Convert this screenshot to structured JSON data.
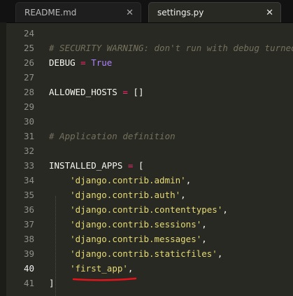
{
  "tabs": [
    {
      "label": "README.md",
      "close": "✕",
      "active": false
    },
    {
      "label": "settings.py",
      "close": "✕",
      "active": true
    }
  ],
  "editor": {
    "current_line": "40",
    "lines": [
      {
        "number": "24",
        "segments": []
      },
      {
        "number": "25",
        "segments": [
          {
            "t": "# SECURITY WARNING: don't run with debug turned on in production!",
            "c": "comment"
          }
        ]
      },
      {
        "number": "26",
        "segments": [
          {
            "t": "DEBUG",
            "c": "plain"
          },
          {
            "t": " ",
            "c": "plain"
          },
          {
            "t": "=",
            "c": "op"
          },
          {
            "t": " ",
            "c": "plain"
          },
          {
            "t": "True",
            "c": "const"
          }
        ]
      },
      {
        "number": "27",
        "segments": []
      },
      {
        "number": "28",
        "segments": [
          {
            "t": "ALLOWED_HOSTS",
            "c": "plain"
          },
          {
            "t": " ",
            "c": "plain"
          },
          {
            "t": "=",
            "c": "op"
          },
          {
            "t": " []",
            "c": "plain"
          }
        ]
      },
      {
        "number": "29",
        "segments": []
      },
      {
        "number": "30",
        "segments": []
      },
      {
        "number": "31",
        "segments": [
          {
            "t": "# Application definition",
            "c": "comment"
          }
        ]
      },
      {
        "number": "32",
        "segments": []
      },
      {
        "number": "33",
        "segments": [
          {
            "t": "INSTALLED_APPS",
            "c": "plain"
          },
          {
            "t": " ",
            "c": "plain"
          },
          {
            "t": "=",
            "c": "op"
          },
          {
            "t": " [",
            "c": "plain"
          }
        ]
      },
      {
        "number": "34",
        "segments": [
          {
            "t": "    ",
            "c": "plain"
          },
          {
            "t": "'django.contrib.admin'",
            "c": "str"
          },
          {
            "t": ",",
            "c": "plain"
          }
        ]
      },
      {
        "number": "35",
        "segments": [
          {
            "t": "    ",
            "c": "plain"
          },
          {
            "t": "'django.contrib.auth'",
            "c": "str"
          },
          {
            "t": ",",
            "c": "plain"
          }
        ]
      },
      {
        "number": "36",
        "segments": [
          {
            "t": "    ",
            "c": "plain"
          },
          {
            "t": "'django.contrib.contenttypes'",
            "c": "str"
          },
          {
            "t": ",",
            "c": "plain"
          }
        ]
      },
      {
        "number": "37",
        "segments": [
          {
            "t": "    ",
            "c": "plain"
          },
          {
            "t": "'django.contrib.sessions'",
            "c": "str"
          },
          {
            "t": ",",
            "c": "plain"
          }
        ]
      },
      {
        "number": "38",
        "segments": [
          {
            "t": "    ",
            "c": "plain"
          },
          {
            "t": "'django.contrib.messages'",
            "c": "str"
          },
          {
            "t": ",",
            "c": "plain"
          }
        ]
      },
      {
        "number": "39",
        "segments": [
          {
            "t": "    ",
            "c": "plain"
          },
          {
            "t": "'django.contrib.staticfiles'",
            "c": "str"
          },
          {
            "t": ",",
            "c": "plain"
          }
        ]
      },
      {
        "number": "40",
        "segments": [
          {
            "t": "    ",
            "c": "plain"
          },
          {
            "t": "'first_app'",
            "c": "str"
          },
          {
            "t": ",",
            "c": "plain"
          }
        ]
      },
      {
        "number": "41",
        "segments": [
          {
            "t": "]",
            "c": "plain"
          }
        ]
      }
    ]
  },
  "annotation": {
    "color": "#e8131b"
  },
  "colors": {
    "background": "#282923",
    "comment": "#75715e",
    "keyword": "#f92672",
    "constant": "#ae81ff",
    "string": "#e6db74"
  }
}
